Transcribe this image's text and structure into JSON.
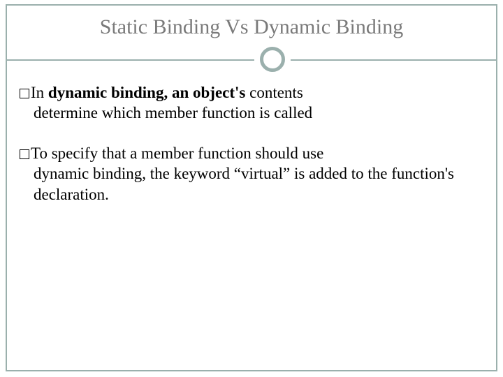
{
  "slide": {
    "title": "Static Binding Vs Dynamic Binding",
    "bullets": [
      {
        "lead": "In ",
        "bold": "dynamic binding, an object's",
        "tail": " contents",
        "cont": "determine which member function is called"
      },
      {
        "lead": "To specify that a member function should use",
        "bold": "",
        "tail": "",
        "cont": "dynamic binding, the keyword “virtual” is added to the function's declaration."
      }
    ]
  }
}
